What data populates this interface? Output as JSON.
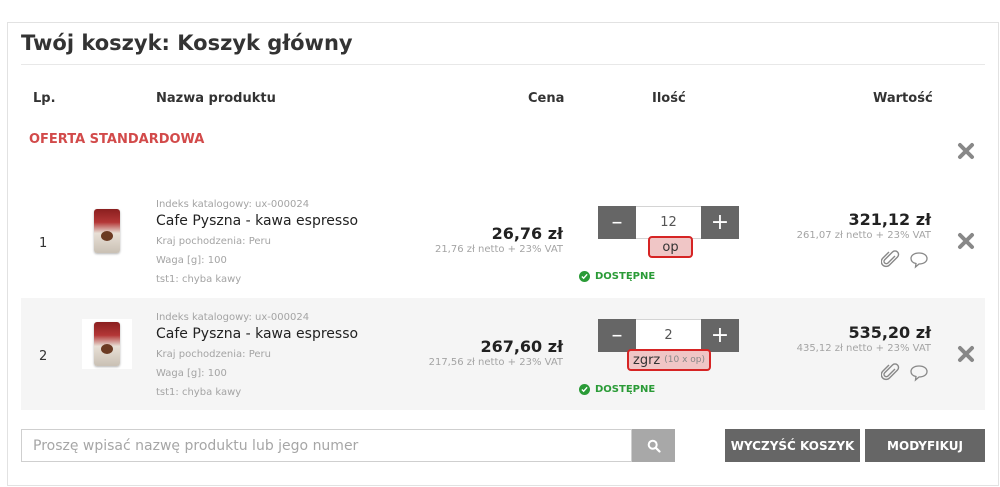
{
  "cart": {
    "title": "Twój koszyk: Koszyk główny",
    "columns": {
      "lp": "Lp.",
      "name": "Nazwa produktu",
      "price": "Cena",
      "qty": "Ilość",
      "value": "Wartość"
    },
    "offer_label": "OFERTA STANDARDOWA",
    "items": [
      {
        "lp": "1",
        "index": "Indeks katalogowy: ux-000024",
        "name": "Cafe Pyszna - kawa espresso",
        "origin": "Kraj pochodzenia: Peru",
        "weight": "Waga [g]: 100",
        "extra": "tst1: chyba kawy",
        "price": "26,76 zł",
        "price_net": "21,76 zł netto + 23% VAT",
        "quantity": "12",
        "unit": "op",
        "unit_mult": "",
        "availability": "DOSTĘPNE",
        "value": "321,12 zł",
        "value_net": "261,07 zł netto + 23% VAT"
      },
      {
        "lp": "2",
        "index": "Indeks katalogowy: ux-000024",
        "name": "Cafe Pyszna - kawa espresso",
        "origin": "Kraj pochodzenia: Peru",
        "weight": "Waga [g]: 100",
        "extra": "tst1: chyba kawy",
        "price": "267,60 zł",
        "price_net": "217,56 zł netto + 23% VAT",
        "quantity": "2",
        "unit": "zgrz",
        "unit_mult": "(10 x op)",
        "availability": "DOSTĘPNE",
        "value": "535,20 zł",
        "value_net": "435,12 zł netto + 23% VAT"
      }
    ],
    "quantity_controls": {
      "minus": "–",
      "plus": "+"
    },
    "search": {
      "placeholder": "Proszę wpisać nazwę produktu lub jego numer",
      "value": ""
    },
    "buttons": {
      "clear": "WYCZYŚĆ KOSZYK",
      "modify": "MODYFIKUJ"
    },
    "icons": {
      "remove": "close-x-icon",
      "search": "magnifier-icon",
      "attach": "paperclip-icon",
      "comment": "speech-bubble-icon",
      "available": "check-circle-icon"
    },
    "colors": {
      "offer": "#d24a4a",
      "available": "#2a9b37",
      "button": "#666666",
      "unit_highlight_border": "#d62424"
    }
  }
}
